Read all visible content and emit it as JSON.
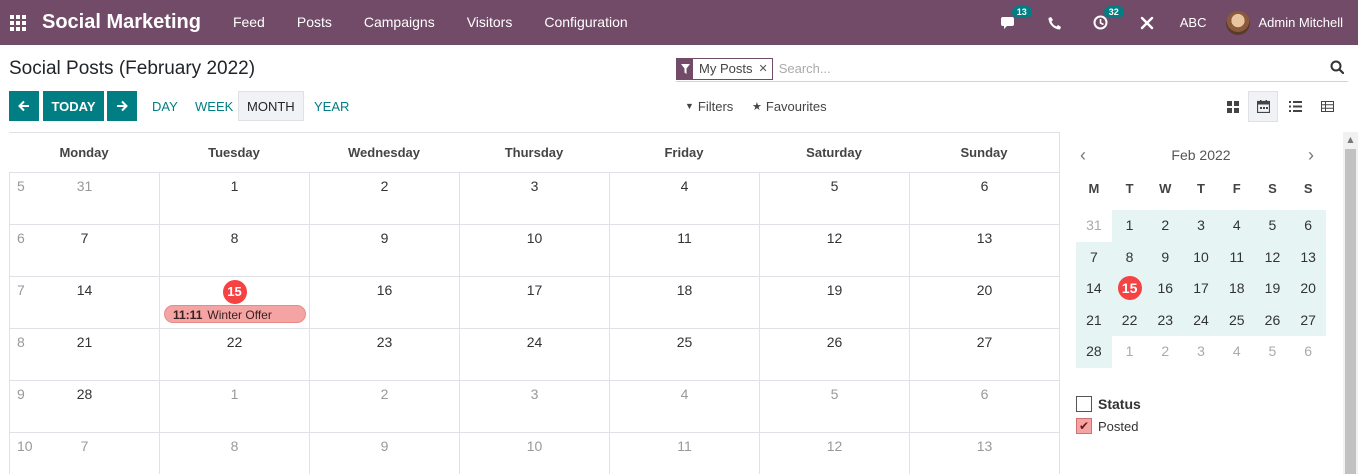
{
  "nav": {
    "brand": "Social Marketing",
    "menu": [
      "Feed",
      "Posts",
      "Campaigns",
      "Visitors",
      "Configuration"
    ],
    "chat_count": "13",
    "activity_count": "32",
    "company": "ABC",
    "user": "Admin Mitchell"
  },
  "page": {
    "title": "Social Posts (February 2022)"
  },
  "search": {
    "facet": "My Posts",
    "placeholder": "Search..."
  },
  "toolbar": {
    "today": "TODAY",
    "scales": [
      "DAY",
      "WEEK",
      "MONTH",
      "YEAR"
    ],
    "filters": "Filters",
    "favourites": "Favourites"
  },
  "calendar": {
    "weekdays": [
      "Monday",
      "Tuesday",
      "Wednesday",
      "Thursday",
      "Friday",
      "Saturday",
      "Sunday"
    ],
    "weeks": [
      {
        "num": "5",
        "days": [
          "31",
          "1",
          "2",
          "3",
          "4",
          "5",
          "6"
        ]
      },
      {
        "num": "6",
        "days": [
          "7",
          "8",
          "9",
          "10",
          "11",
          "12",
          "13"
        ]
      },
      {
        "num": "7",
        "days": [
          "14",
          "15",
          "16",
          "17",
          "18",
          "19",
          "20"
        ]
      },
      {
        "num": "8",
        "days": [
          "21",
          "22",
          "23",
          "24",
          "25",
          "26",
          "27"
        ]
      },
      {
        "num": "9",
        "days": [
          "28",
          "1",
          "2",
          "3",
          "4",
          "5",
          "6"
        ]
      },
      {
        "num": "10",
        "days": [
          "7",
          "8",
          "9",
          "10",
          "11",
          "12",
          "13"
        ]
      }
    ],
    "event": {
      "time": "11:11",
      "title": "Winter Offer"
    }
  },
  "mini": {
    "month": "Feb 2022",
    "dows": [
      "M",
      "T",
      "W",
      "T",
      "F",
      "S",
      "S"
    ],
    "weeks": [
      [
        "31",
        "1",
        "2",
        "3",
        "4",
        "5",
        "6"
      ],
      [
        "7",
        "8",
        "9",
        "10",
        "11",
        "12",
        "13"
      ],
      [
        "14",
        "15",
        "16",
        "17",
        "18",
        "19",
        "20"
      ],
      [
        "21",
        "22",
        "23",
        "24",
        "25",
        "26",
        "27"
      ],
      [
        "28",
        "1",
        "2",
        "3",
        "4",
        "5",
        "6"
      ]
    ]
  },
  "filter": {
    "title": "Status",
    "item": "Posted"
  }
}
